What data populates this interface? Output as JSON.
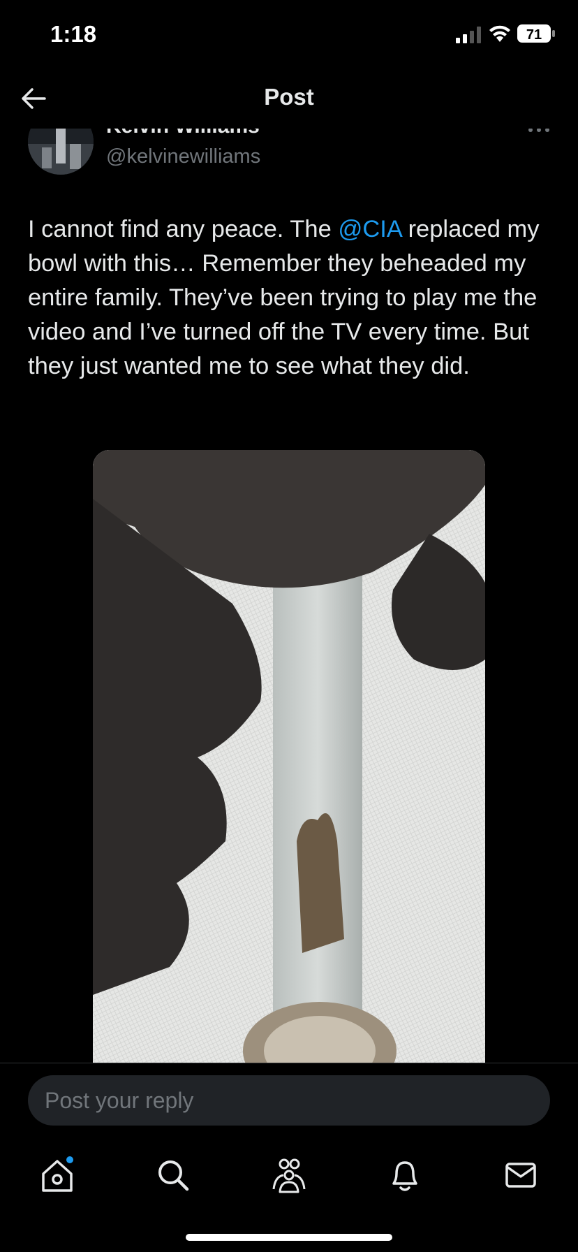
{
  "status_bar": {
    "time": "1:18",
    "battery": "71"
  },
  "header": {
    "title": "Post"
  },
  "post": {
    "author_name": "Kelvin Williams",
    "author_handle": "@kelvinewilliams",
    "text_before": "I cannot find any peace. The ",
    "mention": "@CIA",
    "text_after": " replaced my bowl with this… Remember they beheaded my entire family. They’ve been trying to play me the video and I’ve turned off the TV every time. But they just wanted me to see what they did."
  },
  "reply": {
    "placeholder": "Post your reply"
  },
  "tabs": [
    "home-icon",
    "search-icon",
    "communities-icon",
    "notifications-icon",
    "messages-icon"
  ],
  "colors": {
    "accent": "#1d9bf0",
    "background": "#000000",
    "muted": "#71767b"
  }
}
